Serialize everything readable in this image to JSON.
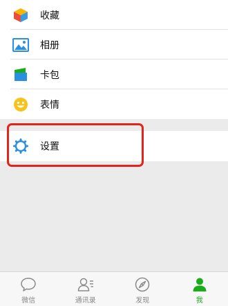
{
  "menu": {
    "items": [
      {
        "label": "收藏",
        "icon": "favorites-cube-icon"
      },
      {
        "label": "相册",
        "icon": "album-image-icon"
      },
      {
        "label": "卡包",
        "icon": "card-wallet-icon"
      },
      {
        "label": "表情",
        "icon": "emoji-smiley-icon"
      }
    ]
  },
  "settings": {
    "label": "设置",
    "icon": "settings-gear-icon"
  },
  "tabbar": {
    "items": [
      {
        "label": "微信",
        "icon": "chat-bubble-icon",
        "active": false
      },
      {
        "label": "通讯录",
        "icon": "contacts-icon",
        "active": false
      },
      {
        "label": "发现",
        "icon": "compass-icon",
        "active": false
      },
      {
        "label": "我",
        "icon": "person-icon",
        "active": true
      }
    ]
  },
  "colors": {
    "accent": "#1aad19",
    "highlight": "#e5231b",
    "background": "#ebebeb"
  }
}
